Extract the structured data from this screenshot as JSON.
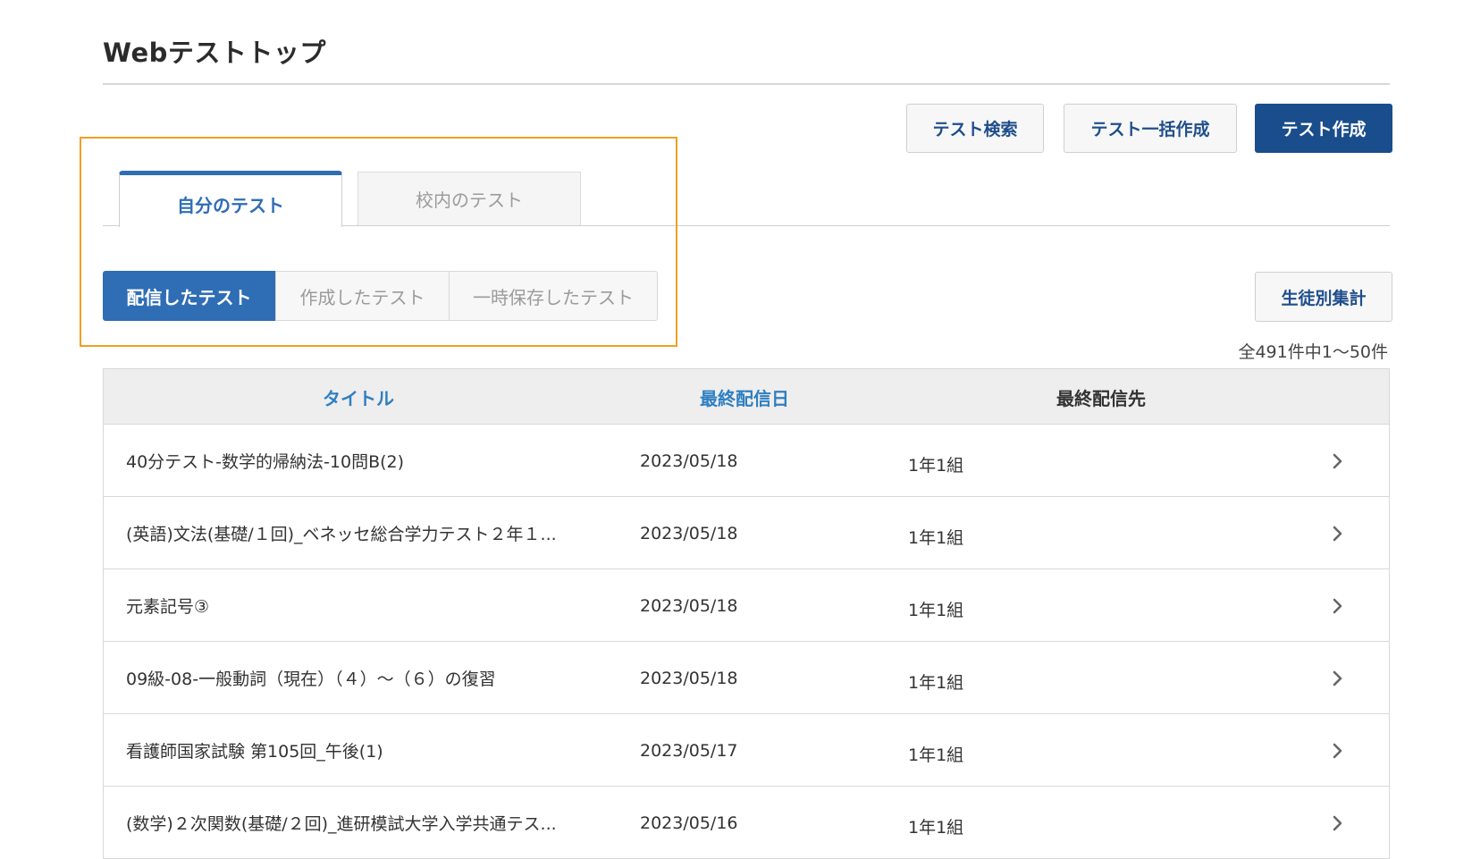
{
  "page": {
    "title": "Webテストトップ"
  },
  "actions": {
    "search_label": "テスト検索",
    "bulk_create_label": "テスト一括作成",
    "create_label": "テスト作成",
    "student_summary_label": "生徒別集計"
  },
  "tabs": [
    {
      "label": "自分のテスト",
      "active": true
    },
    {
      "label": "校内のテスト",
      "active": false
    }
  ],
  "subtabs": [
    {
      "label": "配信したテスト",
      "active": true
    },
    {
      "label": "作成したテスト",
      "active": false
    },
    {
      "label": "一時保存したテスト",
      "active": false
    }
  ],
  "pagination": {
    "count_text": "全491件中1～50件"
  },
  "table": {
    "columns": [
      "タイトル",
      "最終配信日",
      "最終配信先"
    ],
    "rows": [
      {
        "title": "40分テスト-数学的帰納法-10問B(2)",
        "date": "2023/05/18",
        "destination": "1年1組"
      },
      {
        "title": "(英語)文法(基礎/１回)_ベネッセ総合学力テスト２年１...",
        "date": "2023/05/18",
        "destination": "1年1組"
      },
      {
        "title": "元素記号③",
        "date": "2023/05/18",
        "destination": "1年1組"
      },
      {
        "title": "09級-08-一般動詞（現在）（４）～（６）の復習",
        "date": "2023/05/18",
        "destination": "1年1組"
      },
      {
        "title": "看護師国家試験 第105回_午後(1)",
        "date": "2023/05/17",
        "destination": "1年1組"
      },
      {
        "title": "(数学)２次関数(基礎/２回)_進研模試大学入学共通テス...",
        "date": "2023/05/16",
        "destination": "1年1組"
      }
    ]
  },
  "colors": {
    "primary": "#1a4d8c",
    "accent": "#2f6db5",
    "sort_link": "#2f7fc1",
    "highlight_border": "#f0a020"
  }
}
